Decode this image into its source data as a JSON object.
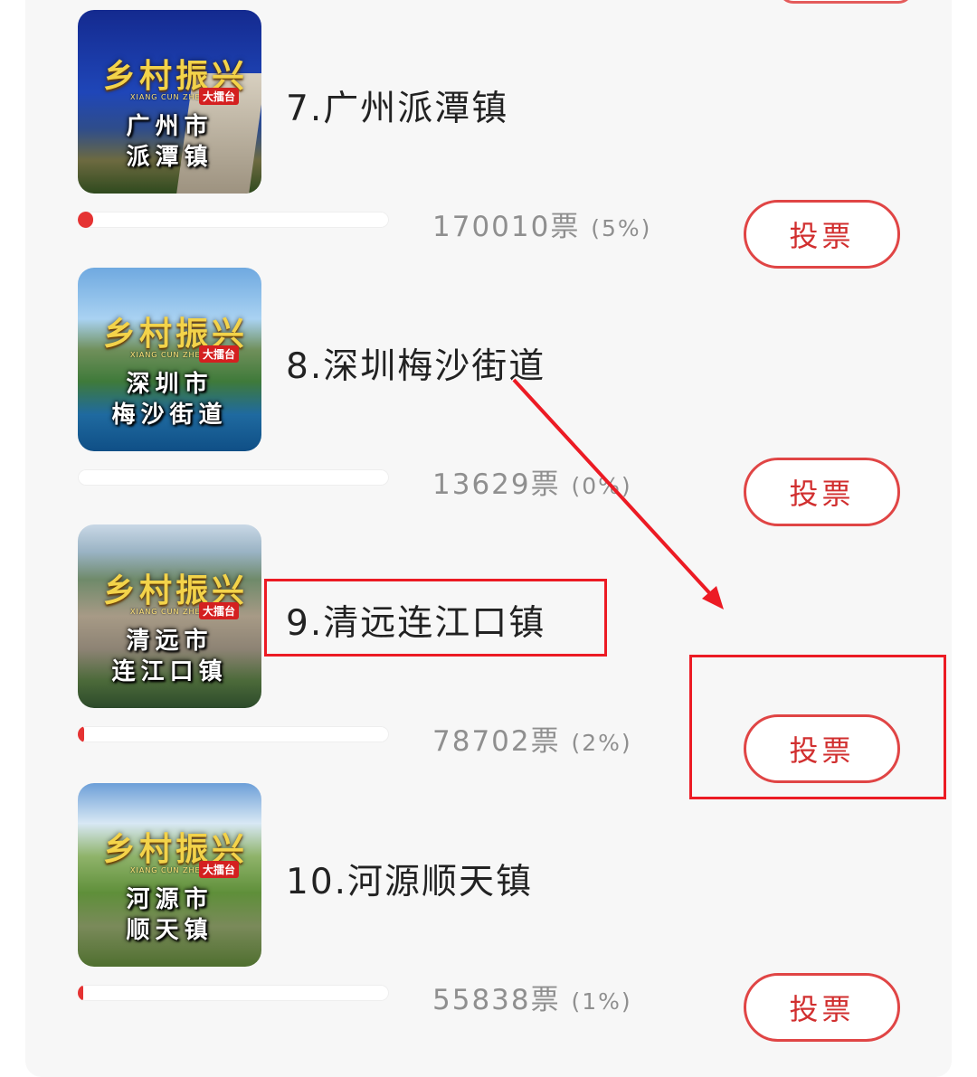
{
  "vote_button_label": "投票",
  "items": [
    {
      "name": "7.广州派潭镇",
      "votes_text": "170010票",
      "percent_text": "(5%)",
      "progress_fraction": 0.05,
      "thumb": {
        "logo": "乡村振兴",
        "pinyin": "XIANG CUN ZHEN XING",
        "badge": "大擂台",
        "line1": "广州市",
        "line2": "派潭镇"
      }
    },
    {
      "name": "8.深圳梅沙街道",
      "votes_text": "13629票",
      "percent_text": "(0%)",
      "progress_fraction": 0.0,
      "thumb": {
        "logo": "乡村振兴",
        "pinyin": "XIANG CUN ZHEN XING",
        "badge": "大擂台",
        "line1": "深圳市",
        "line2": "梅沙街道"
      }
    },
    {
      "name": "9.清远连江口镇",
      "votes_text": "78702票",
      "percent_text": "(2%)",
      "progress_fraction": 0.02,
      "thumb": {
        "logo": "乡村振兴",
        "pinyin": "XIANG CUN ZHEN XING",
        "badge": "大擂台",
        "line1": "清远市",
        "line2": "连江口镇"
      }
    },
    {
      "name": "10.河源顺天镇",
      "votes_text": "55838票",
      "percent_text": "(1%)",
      "progress_fraction": 0.01,
      "thumb": {
        "logo": "乡村振兴",
        "pinyin": "XIANG CUN ZHEN XING",
        "badge": "大擂台",
        "line1": "河源市",
        "line2": "顺天镇"
      }
    }
  ],
  "colors": {
    "accent_red": "#e53333",
    "button_border": "#e04545",
    "annotation_red": "#ec1b24"
  }
}
